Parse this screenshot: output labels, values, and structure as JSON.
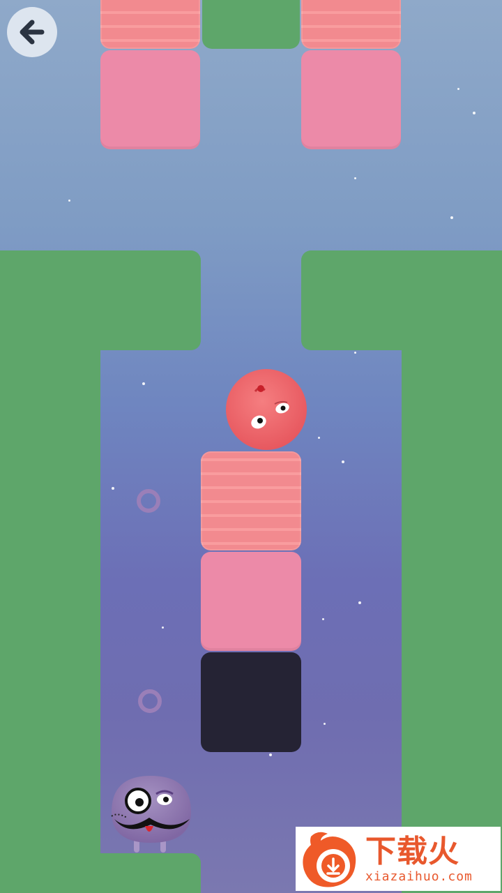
{
  "game": {
    "back_button_icon": "arrow-left-icon",
    "colors": {
      "green_wall": "#5ea66a",
      "pink_block": "#ec8aa8",
      "wavy_block": "#f28a8f",
      "dark_block": "#252334",
      "red_ball": "#f06c72",
      "purple_character": "#8c79aa",
      "ring": "#9a7fb8"
    },
    "characters": [
      "red-ball-character",
      "purple-mustache-character"
    ],
    "collectibles": [
      "purple-ring",
      "purple-ring"
    ]
  },
  "watermark": {
    "title": "下载火",
    "subtitle": "xiazaihuo.com",
    "logo_icon": "flame-download-icon"
  }
}
